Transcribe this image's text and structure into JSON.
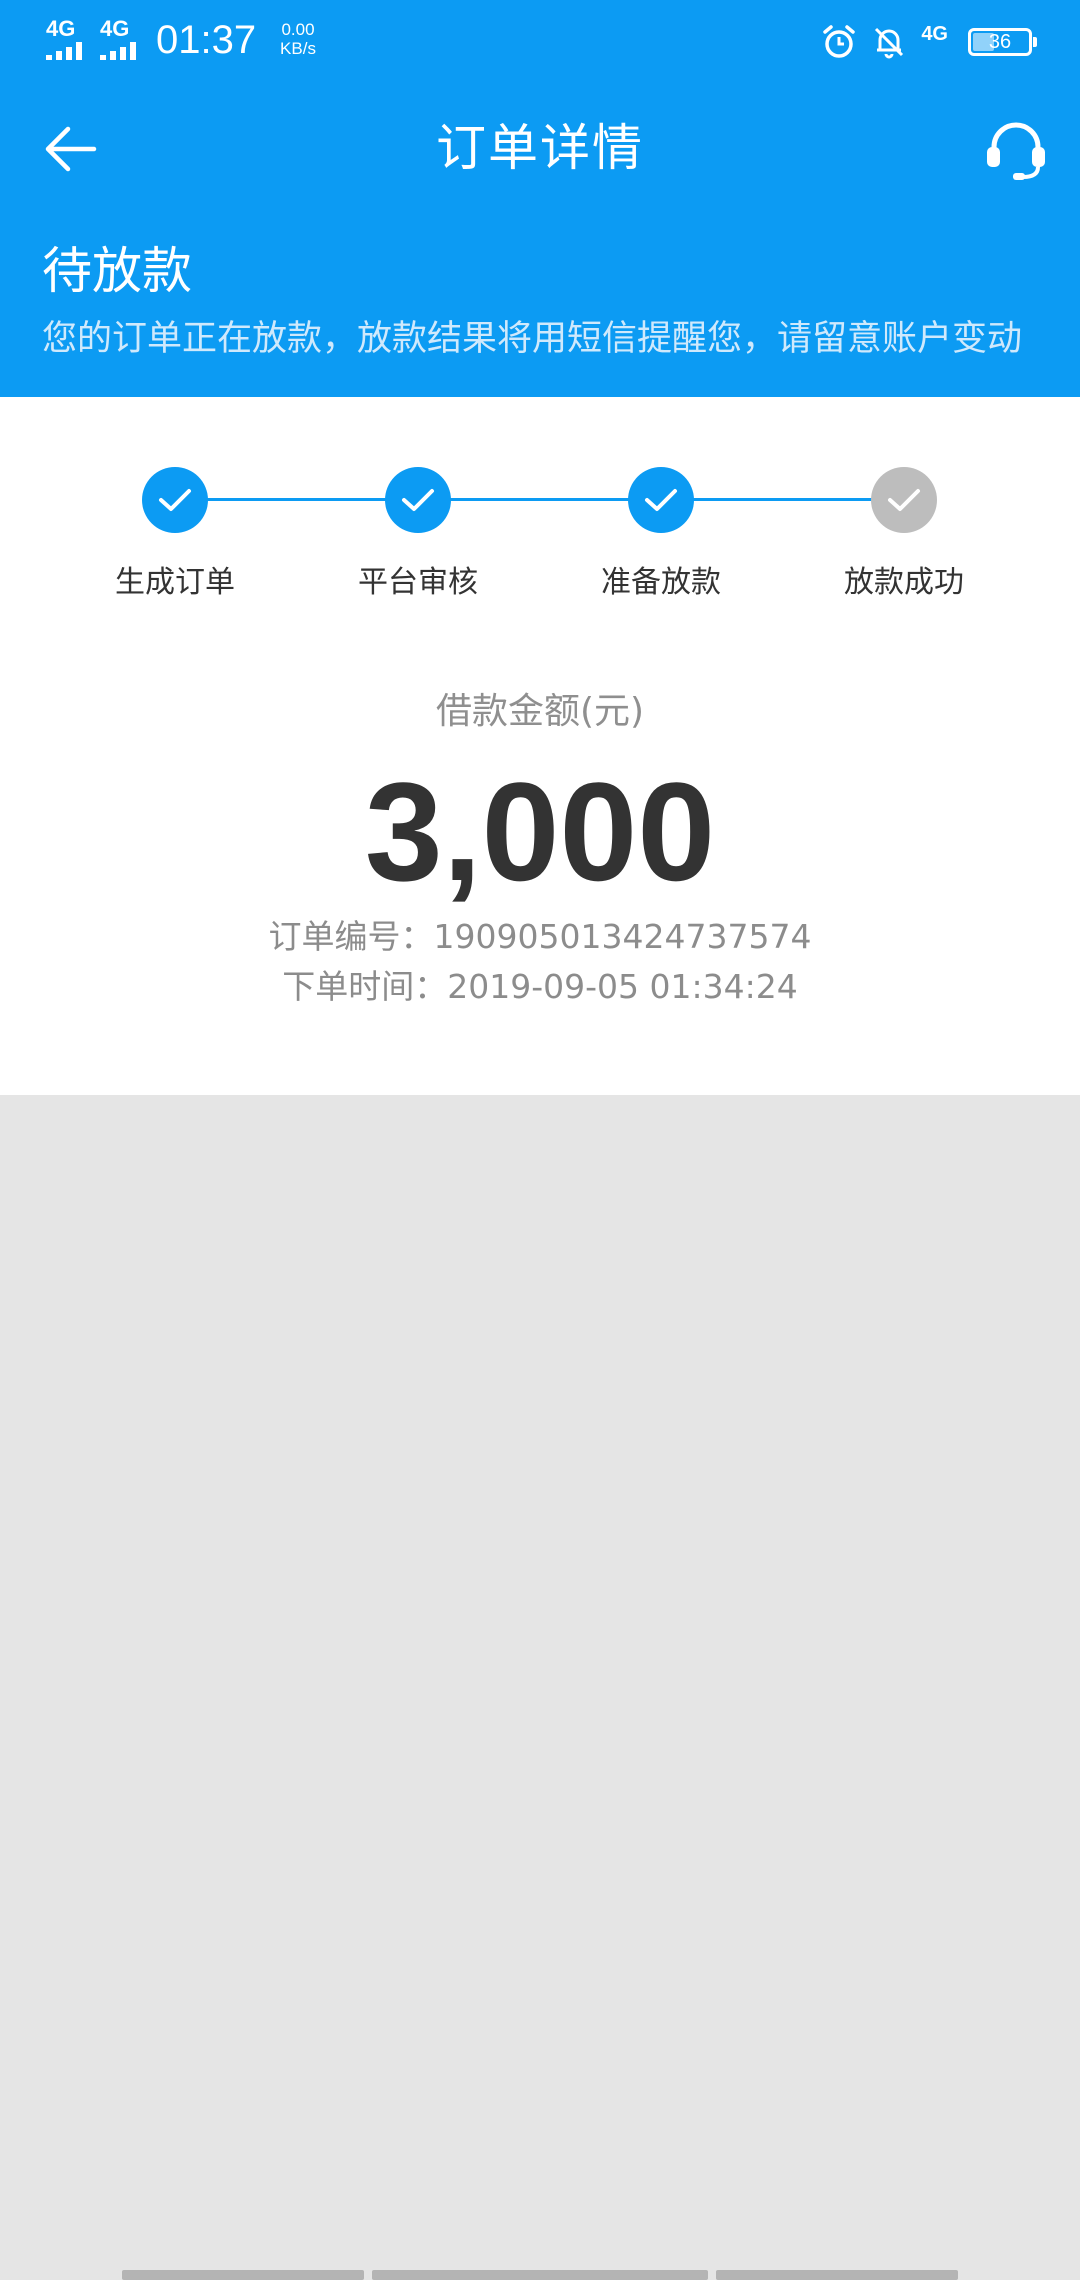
{
  "status_bar": {
    "sim1_network": "4G",
    "sim2_network": "4G",
    "time": "01:37",
    "speed_value": "0.00",
    "speed_unit": "KB/s",
    "right_network": "4G",
    "battery_level": "36",
    "icons": [
      "alarm-icon",
      "bell-off-icon"
    ]
  },
  "app_bar": {
    "title": "订单详情",
    "back_icon": "arrow-left-icon",
    "support_icon": "headset-icon"
  },
  "banner": {
    "title": "待放款",
    "description": "您的订单正在放款，放款结果将用短信提醒您，请留意账户变动"
  },
  "steps": [
    {
      "label": "生成订单",
      "done": true
    },
    {
      "label": "平台审核",
      "done": true
    },
    {
      "label": "准备放款",
      "done": true
    },
    {
      "label": "放款成功",
      "done": false
    }
  ],
  "loan": {
    "amount_label": "借款金额(元)",
    "amount": "3,000",
    "order_no_label": "订单编号：",
    "order_no": "190905013424737574",
    "order_time_label": "下单时间：",
    "order_time": "2019-09-05 01:34:24"
  },
  "colors": {
    "primary": "#0c9bf3",
    "step_done": "#0c9bf3",
    "step_pending": "#bdbdbd",
    "background": "#e5e5e5",
    "text_dark": "#333333",
    "text_muted": "#8c8c8c"
  }
}
